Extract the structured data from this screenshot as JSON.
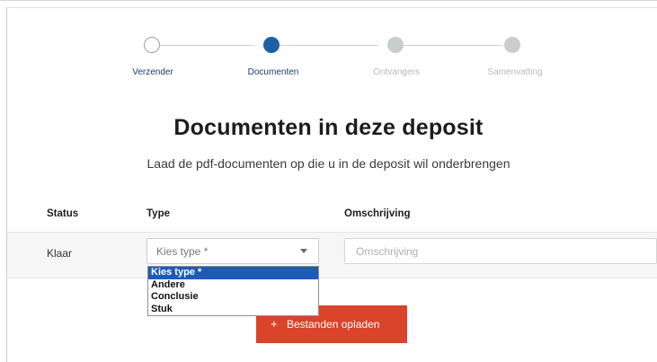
{
  "stepper": {
    "steps": [
      {
        "label": "Verzender",
        "state": "done"
      },
      {
        "label": "Documenten",
        "state": "active"
      },
      {
        "label": "Ontvangers",
        "state": "todo"
      },
      {
        "label": "Samenvatting",
        "state": "todo"
      }
    ]
  },
  "header": {
    "title": "Documenten in deze deposit",
    "subtitle": "Laad de pdf-documenten op die u in de deposit wil onderbrengen"
  },
  "table": {
    "columns": {
      "status": "Status",
      "type": "Type",
      "description": "Omschrijving"
    },
    "row": {
      "status": "Klaar",
      "type_selected": "Kies type *",
      "description_placeholder": "Omschrijving"
    }
  },
  "type_dropdown": {
    "options": [
      "Kies type *",
      "Andere",
      "Conclusie",
      "Stuk"
    ],
    "selected_index": 0
  },
  "upload_button": {
    "icon": "plus-icon",
    "label": "Bestanden opladen"
  },
  "colors": {
    "active_step": "#1f5fa8",
    "selection": "#1d5bb8",
    "upload_button": "#d9442b"
  }
}
